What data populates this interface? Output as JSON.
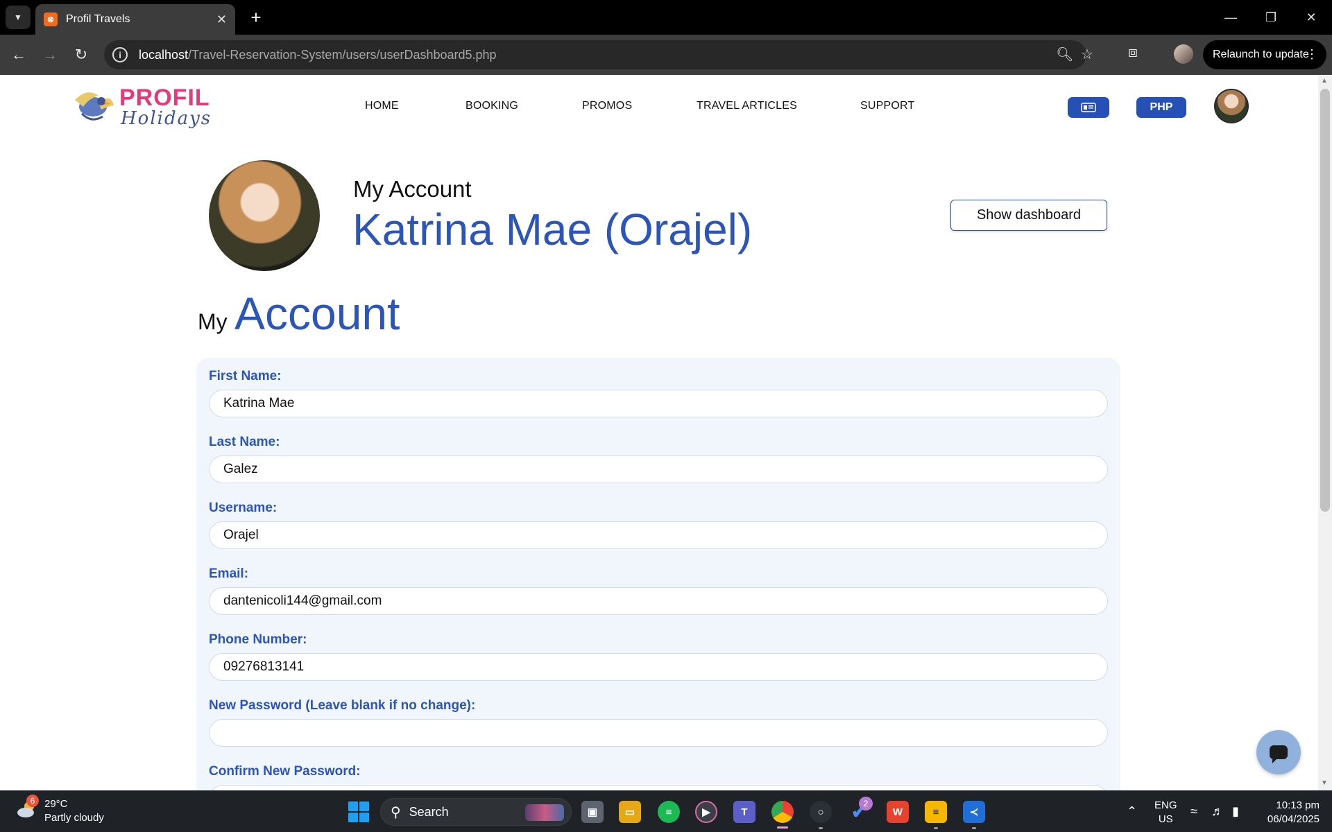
{
  "browser": {
    "tab_title": "Profil Travels",
    "url_host": "localhost",
    "url_path": "/Travel-Reservation-System/users/userDashboard5.php",
    "relaunch_label": "Relaunch to update"
  },
  "site": {
    "logo_main": "PROFIL",
    "logo_sub": "Holidays",
    "nav": [
      "HOME",
      "BOOKING",
      "PROMOS",
      "TRAVEL ARTICLES",
      "SUPPORT"
    ],
    "currency": "PHP"
  },
  "header": {
    "account_label": "My Account",
    "user_display": "Katrina Mae (Orajel)",
    "dashboard_button": "Show dashboard"
  },
  "section": {
    "my": "My",
    "account": "Account"
  },
  "form": {
    "fields": [
      {
        "label": "First Name:",
        "value": "Katrina Mae"
      },
      {
        "label": "Last Name:",
        "value": "Galez"
      },
      {
        "label": "Username:",
        "value": "Orajel"
      },
      {
        "label": "Email:",
        "value": "dantenicoli144@gmail.com"
      },
      {
        "label": "Phone Number:",
        "value": "09276813141"
      },
      {
        "label": "New Password (Leave blank if no change):",
        "value": ""
      },
      {
        "label": "Confirm New Password:",
        "value": ""
      }
    ]
  },
  "taskbar": {
    "weather_badge": "6",
    "temperature": "29°C",
    "condition": "Partly cloudy",
    "search_label": "Search",
    "todo_badge": "2",
    "lang_line1": "ENG",
    "lang_line2": "US",
    "time": "10:13 pm",
    "date": "06/04/2025"
  },
  "colors": {
    "brand_blue": "#2b55b8",
    "logo_pink": "#e43a7a",
    "card_bg": "#f1f5fc"
  }
}
